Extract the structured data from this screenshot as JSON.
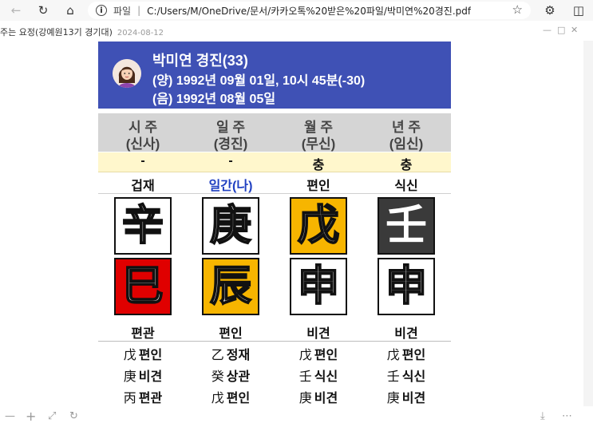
{
  "browser": {
    "scheme_label": "파일",
    "url": "C:/Users/M/OneDrive/문서/카카오톡%20받은%20파일/박미연%20경진.pdf"
  },
  "pdf": {
    "title": "주는 요정(강예원13기 경기대)",
    "date": "2024-08-12"
  },
  "profile": {
    "name_line": "박미연 경진(33)",
    "solar_line": "(양) 1992년 09월 01일, 10시 45분(-30)",
    "lunar_line": "(음) 1992년 08월 05일"
  },
  "columns": [
    {
      "name": "시 주",
      "sub": "(신사)",
      "relation": "-",
      "stem_god": "겁재",
      "stem": "辛",
      "stem_bg": "#ffffff",
      "branch": "巳",
      "branch_bg": "#e00000",
      "branch_god": "편관",
      "hidden": [
        {
          "glyph": "戊",
          "god": "편인"
        },
        {
          "glyph": "庚",
          "god": "비견"
        },
        {
          "glyph": "丙",
          "god": "편관"
        }
      ]
    },
    {
      "name": "일 주",
      "sub": "(경진)",
      "relation": "-",
      "stem_god": "일간(나)",
      "stem": "庚",
      "stem_bg": "#ffffff",
      "branch": "辰",
      "branch_bg": "#f7b500",
      "branch_god": "편인",
      "hidden": [
        {
          "glyph": "乙",
          "god": "정재"
        },
        {
          "glyph": "癸",
          "god": "상관"
        },
        {
          "glyph": "戊",
          "god": "편인"
        }
      ]
    },
    {
      "name": "월 주",
      "sub": "(무신)",
      "relation": "충",
      "stem_god": "편인",
      "stem": "戊",
      "stem_bg": "#f7b500",
      "branch": "申",
      "branch_bg": "#ffffff",
      "branch_god": "비견",
      "hidden": [
        {
          "glyph": "戊",
          "god": "편인"
        },
        {
          "glyph": "壬",
          "god": "식신"
        },
        {
          "glyph": "庚",
          "god": "비견"
        }
      ]
    },
    {
      "name": "년 주",
      "sub": "(임신)",
      "relation": "충",
      "stem_god": "식신",
      "stem": "壬",
      "stem_bg": "#3a3a3a",
      "branch": "申",
      "branch_bg": "#ffffff",
      "branch_god": "비견",
      "hidden": [
        {
          "glyph": "戊",
          "god": "편인"
        },
        {
          "glyph": "壬",
          "god": "식신"
        },
        {
          "glyph": "庚",
          "god": "비견"
        }
      ]
    }
  ],
  "colors": {
    "header_bg": "#3f51b5",
    "pillar_head_bg": "#d5d5d5",
    "relation_bg": "#fff7cc",
    "self_label": "#1f3fc1"
  }
}
